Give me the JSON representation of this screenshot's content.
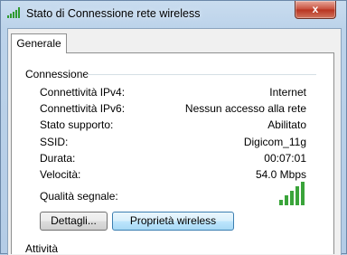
{
  "window": {
    "title": "Stato di Connessione rete wireless",
    "close_label": "x"
  },
  "tabs": [
    {
      "label": "Generale",
      "selected": true
    }
  ],
  "connection": {
    "heading": "Connessione",
    "rows": [
      {
        "label": "Connettività IPv4:",
        "value": "Internet"
      },
      {
        "label": "Connettività IPv6:",
        "value": "Nessun accesso alla rete"
      },
      {
        "label": "Stato supporto:",
        "value": "Abilitato"
      },
      {
        "label": "SSID:",
        "value": "Digicom_11g"
      },
      {
        "label": "Durata:",
        "value": "00:07:01"
      },
      {
        "label": "Velocità:",
        "value": "54.0 Mbps"
      }
    ],
    "signal_label": "Qualità segnale:",
    "signal_bars": 5,
    "signal_bars_max": 5,
    "signal_color": "#3aa43a"
  },
  "buttons": {
    "details": "Dettagli...",
    "wireless_properties": "Proprietà wireless"
  },
  "activity": {
    "heading": "Attività"
  }
}
